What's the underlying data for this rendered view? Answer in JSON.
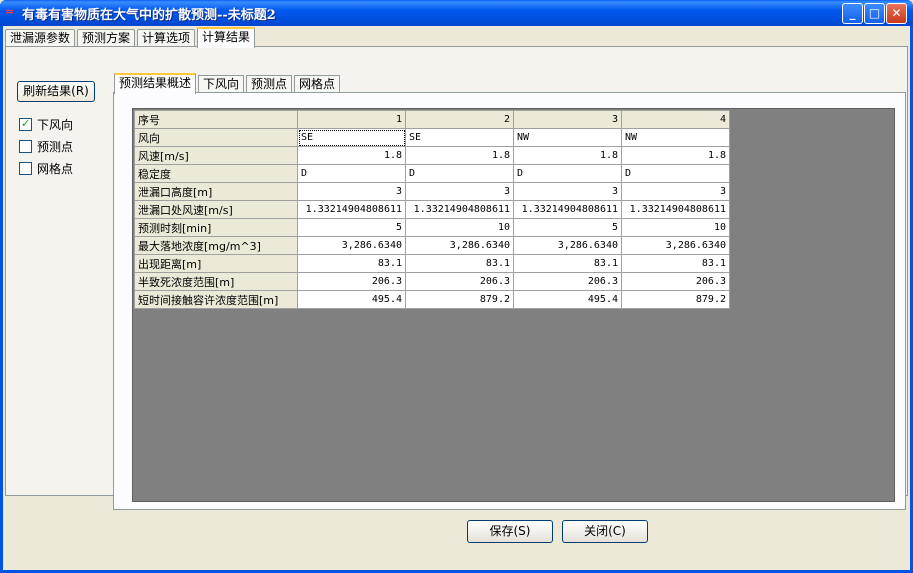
{
  "window": {
    "title": "有毒有害物质在大气中的扩散预测--未标题2",
    "title_icon": "app-icon"
  },
  "tabs": [
    {
      "label": "泄漏源参数"
    },
    {
      "label": "预测方案"
    },
    {
      "label": "计算选项"
    },
    {
      "label": "计算结果"
    }
  ],
  "active_tab": "计算结果",
  "left_panel": {
    "refresh_label": "刷新结果(R)",
    "checkboxes": [
      {
        "label": "下风向",
        "checked": true
      },
      {
        "label": "预测点",
        "checked": false
      },
      {
        "label": "网格点",
        "checked": false
      }
    ]
  },
  "inner_tabs": [
    {
      "label": "预测结果概述"
    },
    {
      "label": "下风向"
    },
    {
      "label": "预测点"
    },
    {
      "label": "网格点"
    }
  ],
  "grid": {
    "header": [
      "序号",
      "1",
      "2",
      "3",
      "4"
    ],
    "rows": [
      [
        "风向",
        "SE",
        "SE",
        "NW",
        "NW"
      ],
      [
        "风速[m/s]",
        "1.8",
        "1.8",
        "1.8",
        "1.8"
      ],
      [
        "稳定度",
        "D",
        "D",
        "D",
        "D"
      ],
      [
        "泄漏口高度[m]",
        "3",
        "3",
        "3",
        "3"
      ],
      [
        "泄漏口处风速[m/s]",
        "1.33214904808611",
        "1.33214904808611",
        "1.33214904808611",
        "1.33214904808611"
      ],
      [
        "预测时刻[min]",
        "5",
        "10",
        "5",
        "10"
      ],
      [
        "最大落地浓度[mg/m^3]",
        "3,286.6340",
        "3,286.6340",
        "3,286.6340",
        "3,286.6340"
      ],
      [
        "出现距离[m]",
        "83.1",
        "83.1",
        "83.1",
        "83.1"
      ],
      [
        "半致死浓度范围[m]",
        "206.3",
        "206.3",
        "206.3",
        "206.3"
      ],
      [
        "短时间接触容许浓度范围[m]",
        "495.4",
        "879.2",
        "495.4",
        "879.2"
      ]
    ]
  },
  "buttons": {
    "save": "保存(S)",
    "close": "关闭(C)"
  }
}
